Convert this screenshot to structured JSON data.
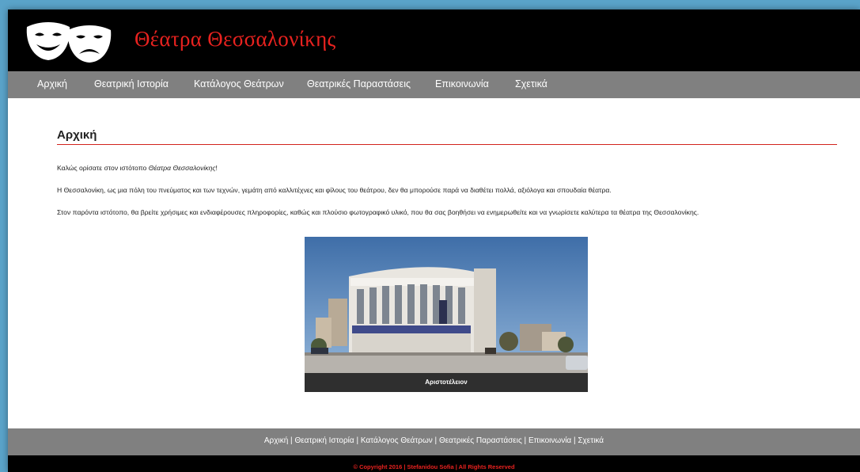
{
  "header": {
    "site_title": "Θέατρα Θεσσαλονίκης",
    "logo_icon": "theatre-masks-icon",
    "title_color": "#e8221f"
  },
  "nav": {
    "items": [
      {
        "label": "Αρχική"
      },
      {
        "label": "Θεατρική Ιστορία"
      },
      {
        "label": "Κατάλογος Θεάτρων"
      },
      {
        "label": "Θεατρικές Παραστάσεις"
      },
      {
        "label": "Επικοινωνία"
      },
      {
        "label": "Σχετικά"
      }
    ]
  },
  "main": {
    "title": "Αρχική",
    "intro_prefix": "Καλώς ορίσατε στον ιστότοπο ",
    "intro_em": "Θέατρα Θεσσαλονίκης",
    "intro_suffix": "!",
    "para2": "Η Θεσσαλονίκη, ως μια πόλη του πνεύματος και των τεχνών, γεμάτη από καλλιτέχνες και φίλους του θεάτρου, δεν θα μπορούσε παρά να διαθέτει πολλά, αξιόλογα και σπουδαία θέατρα.",
    "para3": "Στον παρόντα ιστότοπο, θα βρείτε χρήσιμες και ενδιαφέρουσες πληροφορίες, καθώς και πλούσιο φωτογραφικό υλικό, που θα σας βοηθήσει να ενημερωθείτε και να γνωρίσετε καλύτερα τα θέατρα της Θεσσαλονίκης.",
    "photo_caption": "Αριστοτέλειον"
  },
  "footer": {
    "links": [
      "Αρχική",
      "Θεατρική Ιστορία",
      "Κατάλογος Θεάτρων",
      "Θεατρικές Παραστάσεις",
      "Επικοινωνία",
      "Σχετικά"
    ],
    "separator": " | ",
    "copyright": "© Copyright 2016 | Stefanidou Sofia | All Rights Reserved"
  },
  "colors": {
    "accent": "#e8221f",
    "nav_bg": "#808080",
    "header_bg": "#000000"
  }
}
